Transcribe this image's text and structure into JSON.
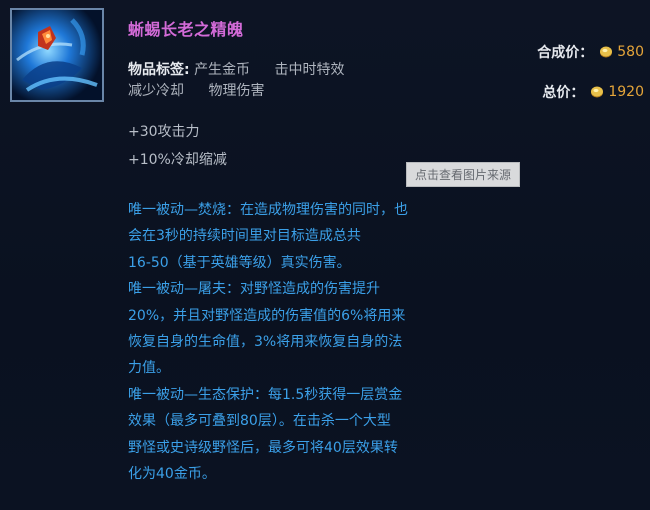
{
  "item": {
    "name": "蜥蜴长老之精魄",
    "icon": "elder-lizard-spirit-icon",
    "tags_label": "物品标签:",
    "tags_line1": [
      "产生金币",
      "击中时特效"
    ],
    "tags_line2": [
      "减少冷却",
      "物理伤害"
    ]
  },
  "prices": {
    "combine_label": "合成价：",
    "combine_value": "580",
    "total_label": "总价：",
    "total_value": "1920",
    "coin_icon": "gold-coin-icon",
    "coin_color": "#e5b43a"
  },
  "stats": [
    "+30攻击力",
    "+10%冷却缩减"
  ],
  "watermark": "点击查看图片来源",
  "passive_lines": [
    "唯一被动—焚烧：在造成物理伤害的同时，也",
    "会在3秒的持续时间里对目标造成总共",
    "16-50（基于英雄等级）真实伤害。",
    "唯一被动—屠夫：对野怪造成的伤害提升",
    "20%，并且对野怪造成的伤害值的6%将用来",
    "恢复自身的生命值，3%将用来恢复自身的法",
    "力值。",
    "唯一被动—生态保护：每1.5秒获得一层赏金",
    "效果（最多可叠到80层）。在击杀一个大型",
    "野怪或史诗级野怪后，最多可将40层效果转",
    "化为40金币。"
  ],
  "colors": {
    "name": "#d36bd8",
    "passive": "#3ba0e8",
    "price": "#e5a53a"
  }
}
